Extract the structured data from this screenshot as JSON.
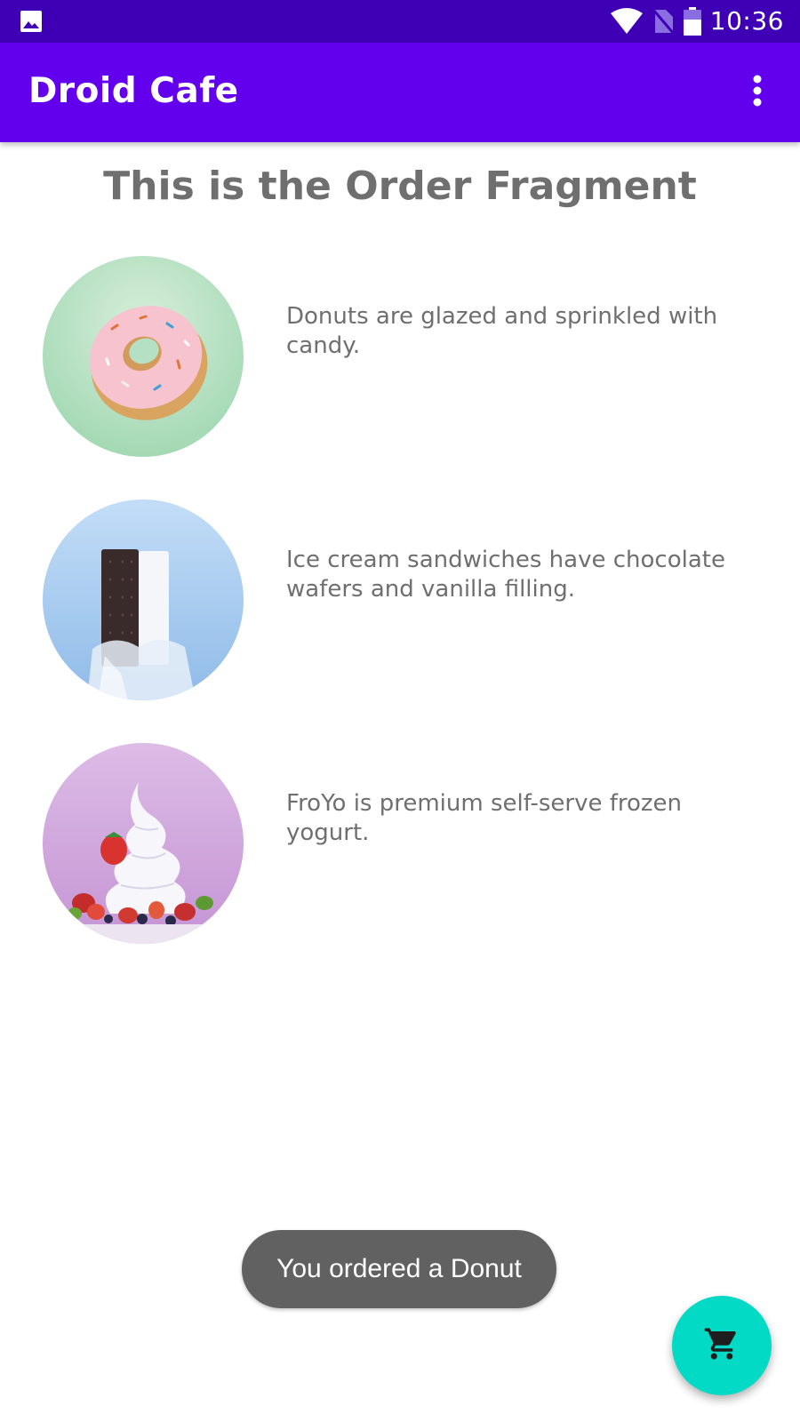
{
  "status_bar": {
    "time": "10:36",
    "icons": [
      "image-notification-icon",
      "wifi-icon",
      "no-sim-icon",
      "battery-icon"
    ]
  },
  "app_bar": {
    "title": "Droid Cafe",
    "overflow_icon": "more-vert-icon"
  },
  "main": {
    "heading": "This is the Order Fragment",
    "items": [
      {
        "name": "donut",
        "description": "Donuts are glazed and sprinkled with candy."
      },
      {
        "name": "ice_cream_sandwich",
        "description": "Ice cream sandwiches have chocolate wafers and vanilla filling."
      },
      {
        "name": "froyo",
        "description": "FroYo is premium self-serve frozen yogurt."
      }
    ]
  },
  "toast": {
    "text": "You ordered a Donut"
  },
  "fab": {
    "icon": "shopping-cart-icon"
  },
  "colors": {
    "status_bar": "#3f00b5",
    "app_bar": "#6200ee",
    "fab": "#03dac5",
    "text": "#6f6f6f",
    "toast": "#616161"
  }
}
